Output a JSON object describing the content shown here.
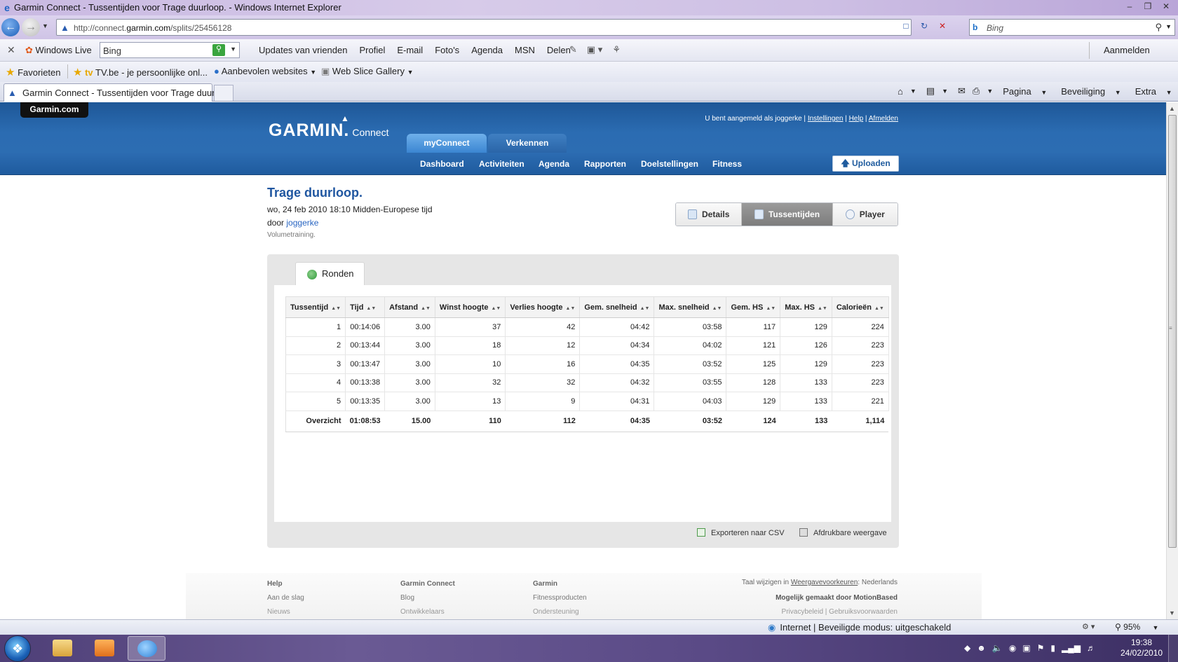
{
  "window": {
    "title": "Garmin Connect - Tussentijden voor Trage duurloop. - Windows Internet Explorer"
  },
  "address": {
    "url_prefix": "http://connect.",
    "url_domain": "garmin.com",
    "url_path": "/splits/25456128"
  },
  "search": {
    "placeholder": "Bing"
  },
  "live_toolbar": {
    "brand": "Windows Live",
    "search_value": "Bing",
    "links": [
      "Updates van vrienden",
      "Profiel",
      "E-mail",
      "Foto's",
      "Agenda",
      "MSN",
      "Delen"
    ],
    "signin": "Aanmelden"
  },
  "favorites": {
    "label": "Favorieten",
    "items": [
      "TV.be - je persoonlijke onl...",
      "Aanbevolen websites",
      "Web Slice Gallery"
    ],
    "tv_prefix": "tv"
  },
  "tab": {
    "label": "Garmin Connect - Tussentijden voor Trage duurl..."
  },
  "commands": {
    "page": "Pagina",
    "safety": "Beveiliging",
    "extra": "Extra"
  },
  "site": {
    "home_link": "Garmin.com",
    "logo_main": "GARMIN.",
    "logo_sub": "Connect",
    "user_text": "U bent aangemeld als joggerke",
    "settings": "Instellingen",
    "help": "Help",
    "logout": "Afmelden",
    "top_tabs": [
      "myConnect",
      "Verkennen"
    ],
    "nav": [
      "Dashboard",
      "Activiteiten",
      "Agenda",
      "Rapporten",
      "Doelstellingen",
      "Fitness"
    ],
    "upload": "Uploaden"
  },
  "activity": {
    "title": "Trage duurloop.",
    "datetime": "wo, 24 feb 2010 18:10 Midden-Europese tijd",
    "by_label": "door",
    "by_user": "joggerke",
    "type": "Volumetraining."
  },
  "view_buttons": [
    "Details",
    "Tussentijden",
    "Player"
  ],
  "panel": {
    "tab": "Ronden",
    "export_csv": "Exporteren naar CSV",
    "print_view": "Afdrukbare weergave"
  },
  "splits": {
    "columns": [
      "Tussentijd",
      "Tijd",
      "Afstand",
      "Winst hoogte",
      "Verlies hoogte",
      "Gem. snelheid",
      "Max. snelheid",
      "Gem. HS",
      "Max. HS",
      "Calorieën"
    ],
    "rows": [
      [
        "1",
        "00:14:06",
        "3.00",
        "37",
        "42",
        "04:42",
        "03:58",
        "117",
        "129",
        "224"
      ],
      [
        "2",
        "00:13:44",
        "3.00",
        "18",
        "12",
        "04:34",
        "04:02",
        "121",
        "126",
        "223"
      ],
      [
        "3",
        "00:13:47",
        "3.00",
        "10",
        "16",
        "04:35",
        "03:52",
        "125",
        "129",
        "223"
      ],
      [
        "4",
        "00:13:38",
        "3.00",
        "32",
        "32",
        "04:32",
        "03:55",
        "128",
        "133",
        "223"
      ],
      [
        "5",
        "00:13:35",
        "3.00",
        "13",
        "9",
        "04:31",
        "04:03",
        "129",
        "133",
        "221"
      ]
    ],
    "summary": [
      "Overzicht",
      "01:08:53",
      "15.00",
      "110",
      "112",
      "04:35",
      "03:52",
      "124",
      "133",
      "1,114"
    ]
  },
  "footer": {
    "col1": {
      "head": "Help",
      "item": "Aan de slag",
      "cut": "Nieuws"
    },
    "col2": {
      "head": "Garmin Connect",
      "item": "Blog",
      "cut": "Ontwikkelaars"
    },
    "col3": {
      "head": "Garmin",
      "item": "Fitnessproducten",
      "cut": "Ondersteuning"
    },
    "lang_prefix": "Taal wijzigen in",
    "lang_link": "Weergavevoorkeuren",
    "lang_value": ": Nederlands",
    "motionbased": "Mogelijk gemaakt door MotionBased",
    "privacy": "Privacybeleid | Gebruiksvoorwaarden"
  },
  "statusbar": {
    "zone": "Internet | Beveiligde modus: uitgeschakeld",
    "zoom": "95%"
  },
  "taskbar": {
    "time": "19:38",
    "date": "24/02/2010"
  }
}
